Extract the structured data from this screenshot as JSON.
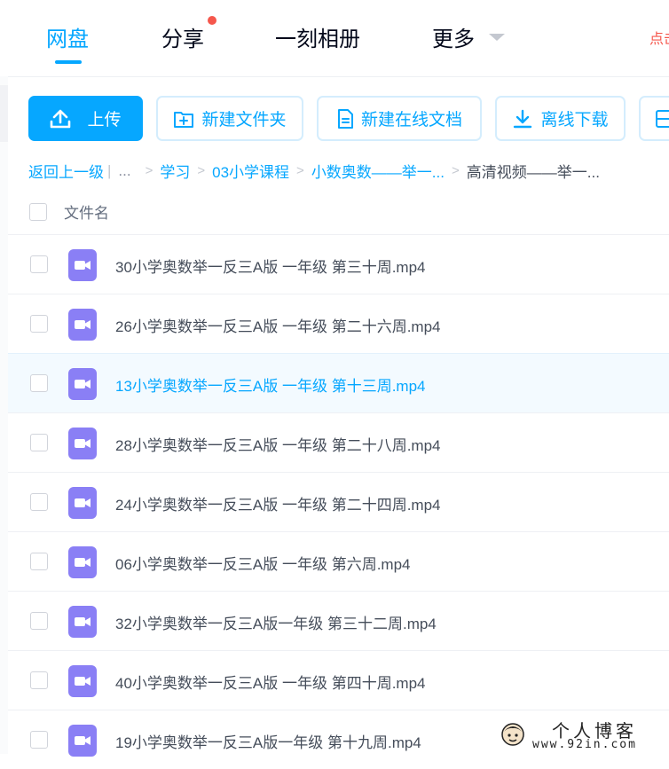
{
  "nav": {
    "tabs": [
      {
        "label": "网盘"
      },
      {
        "label": "分享"
      },
      {
        "label": "一刻相册"
      },
      {
        "label": "更多"
      }
    ],
    "right_text": "点击"
  },
  "toolbar": {
    "upload_label": "上传",
    "new_folder_label": "新建文件夹",
    "new_doc_label": "新建在线文档",
    "offline_download_label": "离线下载"
  },
  "breadcrumb": {
    "back_label": "返回上一级",
    "ellipsis": "...",
    "items": [
      "学习",
      "03小学课程",
      "小数奥数——举一..."
    ],
    "current": "高清视频——举一..."
  },
  "list": {
    "header_label": "文件名",
    "files": [
      {
        "name": "30小学奥数举一反三A版 一年级 第三十周.mp4"
      },
      {
        "name": "26小学奥数举一反三A版 一年级 第二十六周.mp4"
      },
      {
        "name": "13小学奥数举一反三A版 一年级 第十三周.mp4"
      },
      {
        "name": "28小学奥数举一反三A版 一年级 第二十八周.mp4"
      },
      {
        "name": "24小学奥数举一反三A版 一年级 第二十四周.mp4"
      },
      {
        "name": "06小学奥数举一反三A版 一年级 第六周.mp4"
      },
      {
        "name": "32小学奥数举一反三A版一年级 第三十二周.mp4"
      },
      {
        "name": "40小学奥数举一反三A版 一年级 第四十周.mp4"
      },
      {
        "name": "19小学奥数举一反三A版一年级 第十九周.mp4"
      }
    ]
  },
  "watermark": {
    "title": "个人博客",
    "url": "www.92in.com"
  },
  "colors": {
    "accent": "#06a7ff",
    "video_icon": "#8a7ff5",
    "notification_dot": "#f5574c"
  }
}
